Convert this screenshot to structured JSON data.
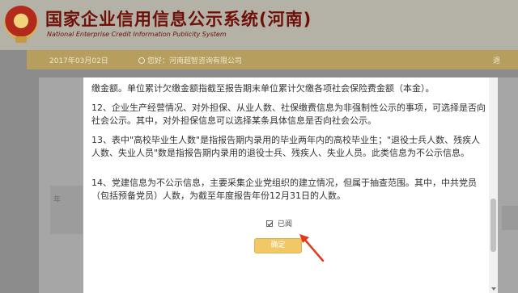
{
  "header": {
    "title": "国家企业信用信息公示系统(河南)",
    "subtitle": "National Enterprise Credit Information Publicity System"
  },
  "info_bar": {
    "date": "2017年03月02日",
    "user": "您好：河南超智咨询有限公司",
    "right": "退"
  },
  "background": {
    "left_label": "年"
  },
  "modal": {
    "paragraphs": {
      "first": "缴金额。单位累计欠缴金额指截至报告期末单位累计欠缴各项社会保险费金额（本金）。",
      "p12": "12、企业生产经营情况、对外担保、从业人数、社保缴费信息为非强制性公示的事项，可选择是否向社会公示。其中，对外担保信息可以选择某条具体信息是否向社会公示。",
      "p13": "13、表中\"高校毕业生人数\"是指报告期内录用的毕业两年内的高校毕业生；\"退役士兵人数、残疾人人数、失业人员\"数是指报告期内录用的退役士兵、残疾人、失业人员。此类信息为不公示信息。",
      "p14": "14、党建信息为不公示信息，主要采集企业党组织的建立情况，但属于抽查范围。其中，中共党员（包括预备党员）人数，为截至年度报告年份12月31日的人数。"
    },
    "checkbox_label": "已阅",
    "confirm_label": "确定"
  },
  "colors": {
    "header_bg": "#b4b1a6",
    "title_red": "#6e0f08",
    "info_bar": "#b59e5e",
    "button": "#f0c866",
    "arrow": "#e0391e"
  }
}
